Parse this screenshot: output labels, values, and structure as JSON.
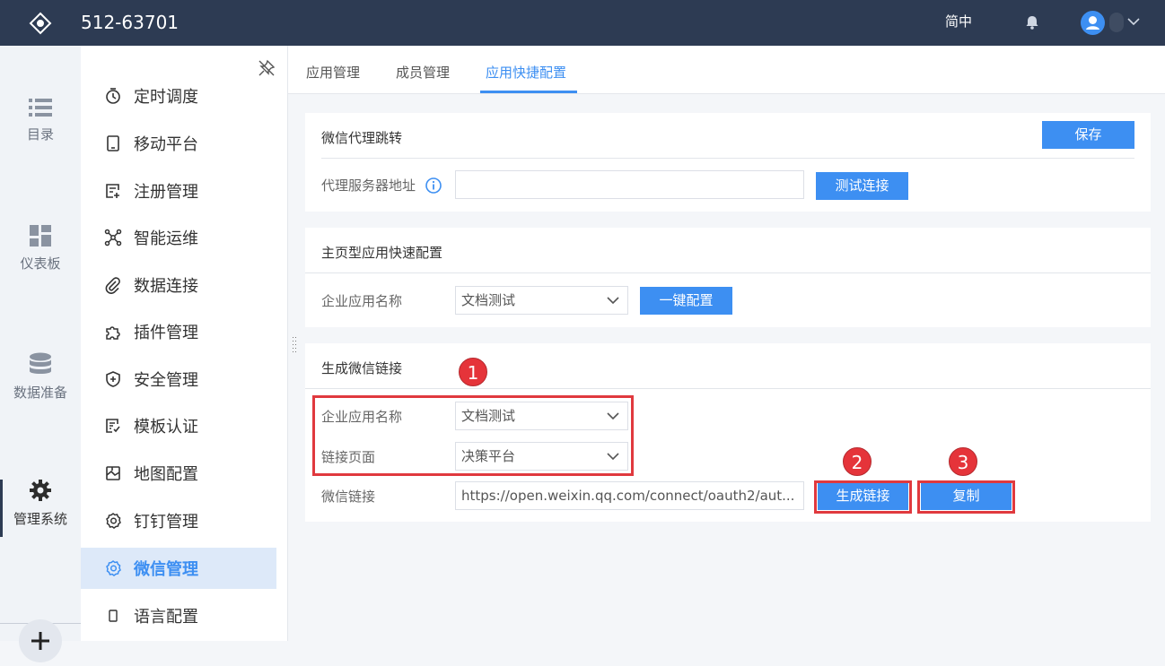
{
  "header": {
    "title": "512-63701",
    "language": "简中"
  },
  "rail": {
    "items": [
      {
        "label": "目录",
        "icon": "list-icon"
      },
      {
        "label": "仪表板",
        "icon": "dashboard-icon"
      },
      {
        "label": "数据准备",
        "icon": "database-icon"
      },
      {
        "label": "管理系统",
        "icon": "gear-icon"
      }
    ]
  },
  "menu": {
    "items": [
      {
        "label": "定时调度",
        "icon": "timer-icon"
      },
      {
        "label": "移动平台",
        "icon": "mobile-icon"
      },
      {
        "label": "注册管理",
        "icon": "register-icon"
      },
      {
        "label": "智能运维",
        "icon": "network-icon"
      },
      {
        "label": "数据连接",
        "icon": "link-icon"
      },
      {
        "label": "插件管理",
        "icon": "puzzle-icon"
      },
      {
        "label": "安全管理",
        "icon": "shield-icon"
      },
      {
        "label": "模板认证",
        "icon": "template-icon"
      },
      {
        "label": "地图配置",
        "icon": "map-icon"
      },
      {
        "label": "钉钉管理",
        "icon": "gear-small-icon"
      },
      {
        "label": "微信管理",
        "icon": "gear-small-icon"
      },
      {
        "label": "语言配置",
        "icon": "phone-icon"
      }
    ]
  },
  "tabs": [
    {
      "label": "应用管理"
    },
    {
      "label": "成员管理"
    },
    {
      "label": "应用快捷配置"
    }
  ],
  "proxy_section": {
    "title": "微信代理跳转",
    "save_label": "保存",
    "server_label": "代理服务器地址",
    "server_value": "",
    "test_label": "测试连接"
  },
  "quick_section": {
    "title": "主页型应用快速配置",
    "app_label": "企业应用名称",
    "app_value": "文档测试",
    "config_label": "一键配置"
  },
  "link_section": {
    "title": "生成微信链接",
    "app_label": "企业应用名称",
    "app_value": "文档测试",
    "page_label": "链接页面",
    "page_value": "决策平台",
    "link_label": "微信链接",
    "link_value": "https://open.weixin.qq.com/connect/oauth2/aut...",
    "generate_label": "生成链接",
    "copy_label": "复制"
  },
  "annotations": {
    "badge1": "1",
    "badge2": "2",
    "badge3": "3"
  },
  "colors": {
    "header_bg": "#2d3b53",
    "accent": "#3d8ff2",
    "highlight": "#e0393e"
  }
}
